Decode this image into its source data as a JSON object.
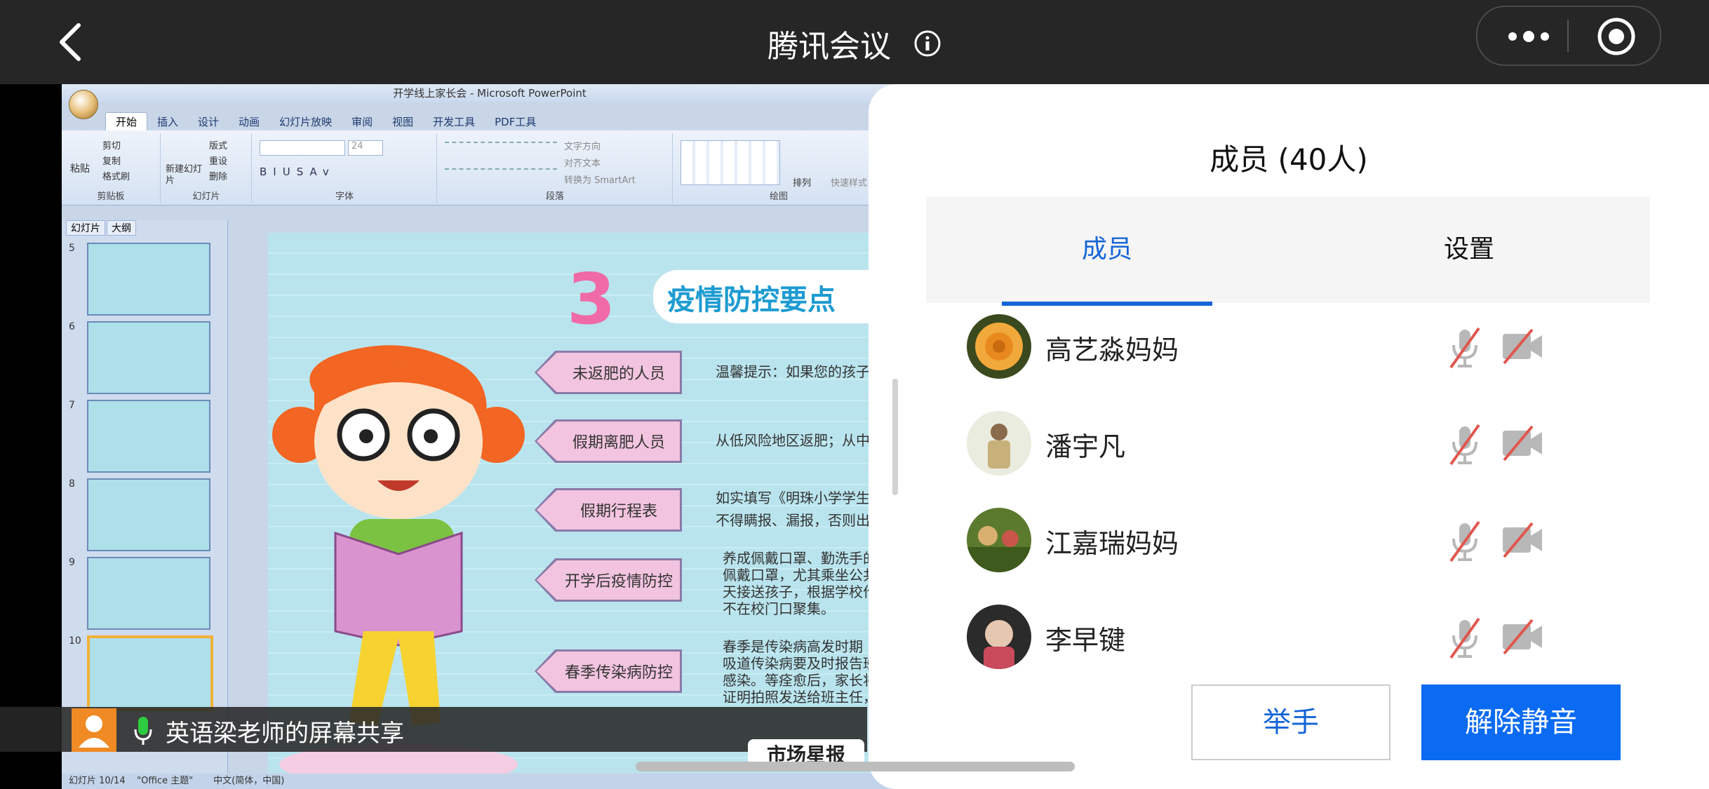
{
  "topbar": {
    "title": "腾讯会议"
  },
  "shared_screen": {
    "ppt": {
      "window_title": "开学线上家长会 - Microsoft PowerPoint",
      "ribbon_tabs": [
        "开始",
        "插入",
        "设计",
        "动画",
        "幻灯片放映",
        "审阅",
        "视图",
        "开发工具",
        "PDF工具"
      ],
      "groups": {
        "clipboard": {
          "name": "剪贴板",
          "items": [
            "剪切",
            "复制",
            "格式刷",
            "粘贴"
          ]
        },
        "slides": {
          "name": "幻灯片",
          "items": [
            "版式",
            "重设",
            "删除",
            "新建幻灯片"
          ]
        },
        "font": {
          "name": "字体",
          "size": "24"
        },
        "paragraph": {
          "name": "段落",
          "items": [
            "文字方向",
            "对齐文本",
            "转换为 SmartArt"
          ]
        },
        "drawing": {
          "name": "绘图",
          "items": [
            "排列",
            "快速样式"
          ]
        }
      },
      "pane_tabs": [
        "幻灯片",
        "大纲"
      ],
      "thumb_numbers": [
        "5",
        "6",
        "7",
        "8",
        "9",
        "10"
      ],
      "slide": {
        "number_badge": "3",
        "title": "疫情防控要点",
        "tags": [
          "未返肥的人员",
          "假期离肥人员",
          "假期行程表",
          "开学后疫情防控",
          "春季传染病防控"
        ],
        "texts": [
          "温馨提示：如果您的孩子",
          "从低风险地区返肥；从中",
          "如实填写《明珠小学学生",
          "不得瞒报、漏报，否则出",
          "养成佩戴口罩、勤洗手的",
          "佩戴口罩，尤其乘坐公共",
          "天接送孩子，根据学校作",
          "不在校门口聚集。",
          "春季是传染病高发时期",
          "吸道传染病要及时报告班",
          "感染。等痊愈后，家长将",
          "证明拍照发送给班主任，"
        ]
      },
      "status": {
        "slide_count": "幻灯片 10/14",
        "theme": "\"Office 主题\"",
        "language": "中文(简体，中国)"
      }
    },
    "share_label": "英语梁老师的屏幕共享",
    "stamp": "市场星报"
  },
  "panel": {
    "title": "成员 (40人)",
    "tabs": {
      "members": "成员",
      "settings": "设置"
    },
    "members": [
      {
        "name": "高艺淼妈妈",
        "mic": "muted",
        "camera": "off"
      },
      {
        "name": "潘宇凡",
        "mic": "muted",
        "camera": "off"
      },
      {
        "name": "江嘉瑞妈妈",
        "mic": "muted",
        "camera": "off"
      },
      {
        "name": "李早键",
        "mic": "muted",
        "camera": "off"
      }
    ],
    "raise_hand_label": "举手",
    "unmute_label": "解除静音"
  },
  "colors": {
    "accent": "#1565d8",
    "unmute_button": "#0a6bf2",
    "muted_slash": "#e0574f",
    "topbar": "#262626"
  },
  "icons": [
    "back-icon",
    "info-icon",
    "more-dots-icon",
    "record-icon",
    "mic-muted-icon",
    "camera-off-icon",
    "mic-icon",
    "user-icon"
  ]
}
